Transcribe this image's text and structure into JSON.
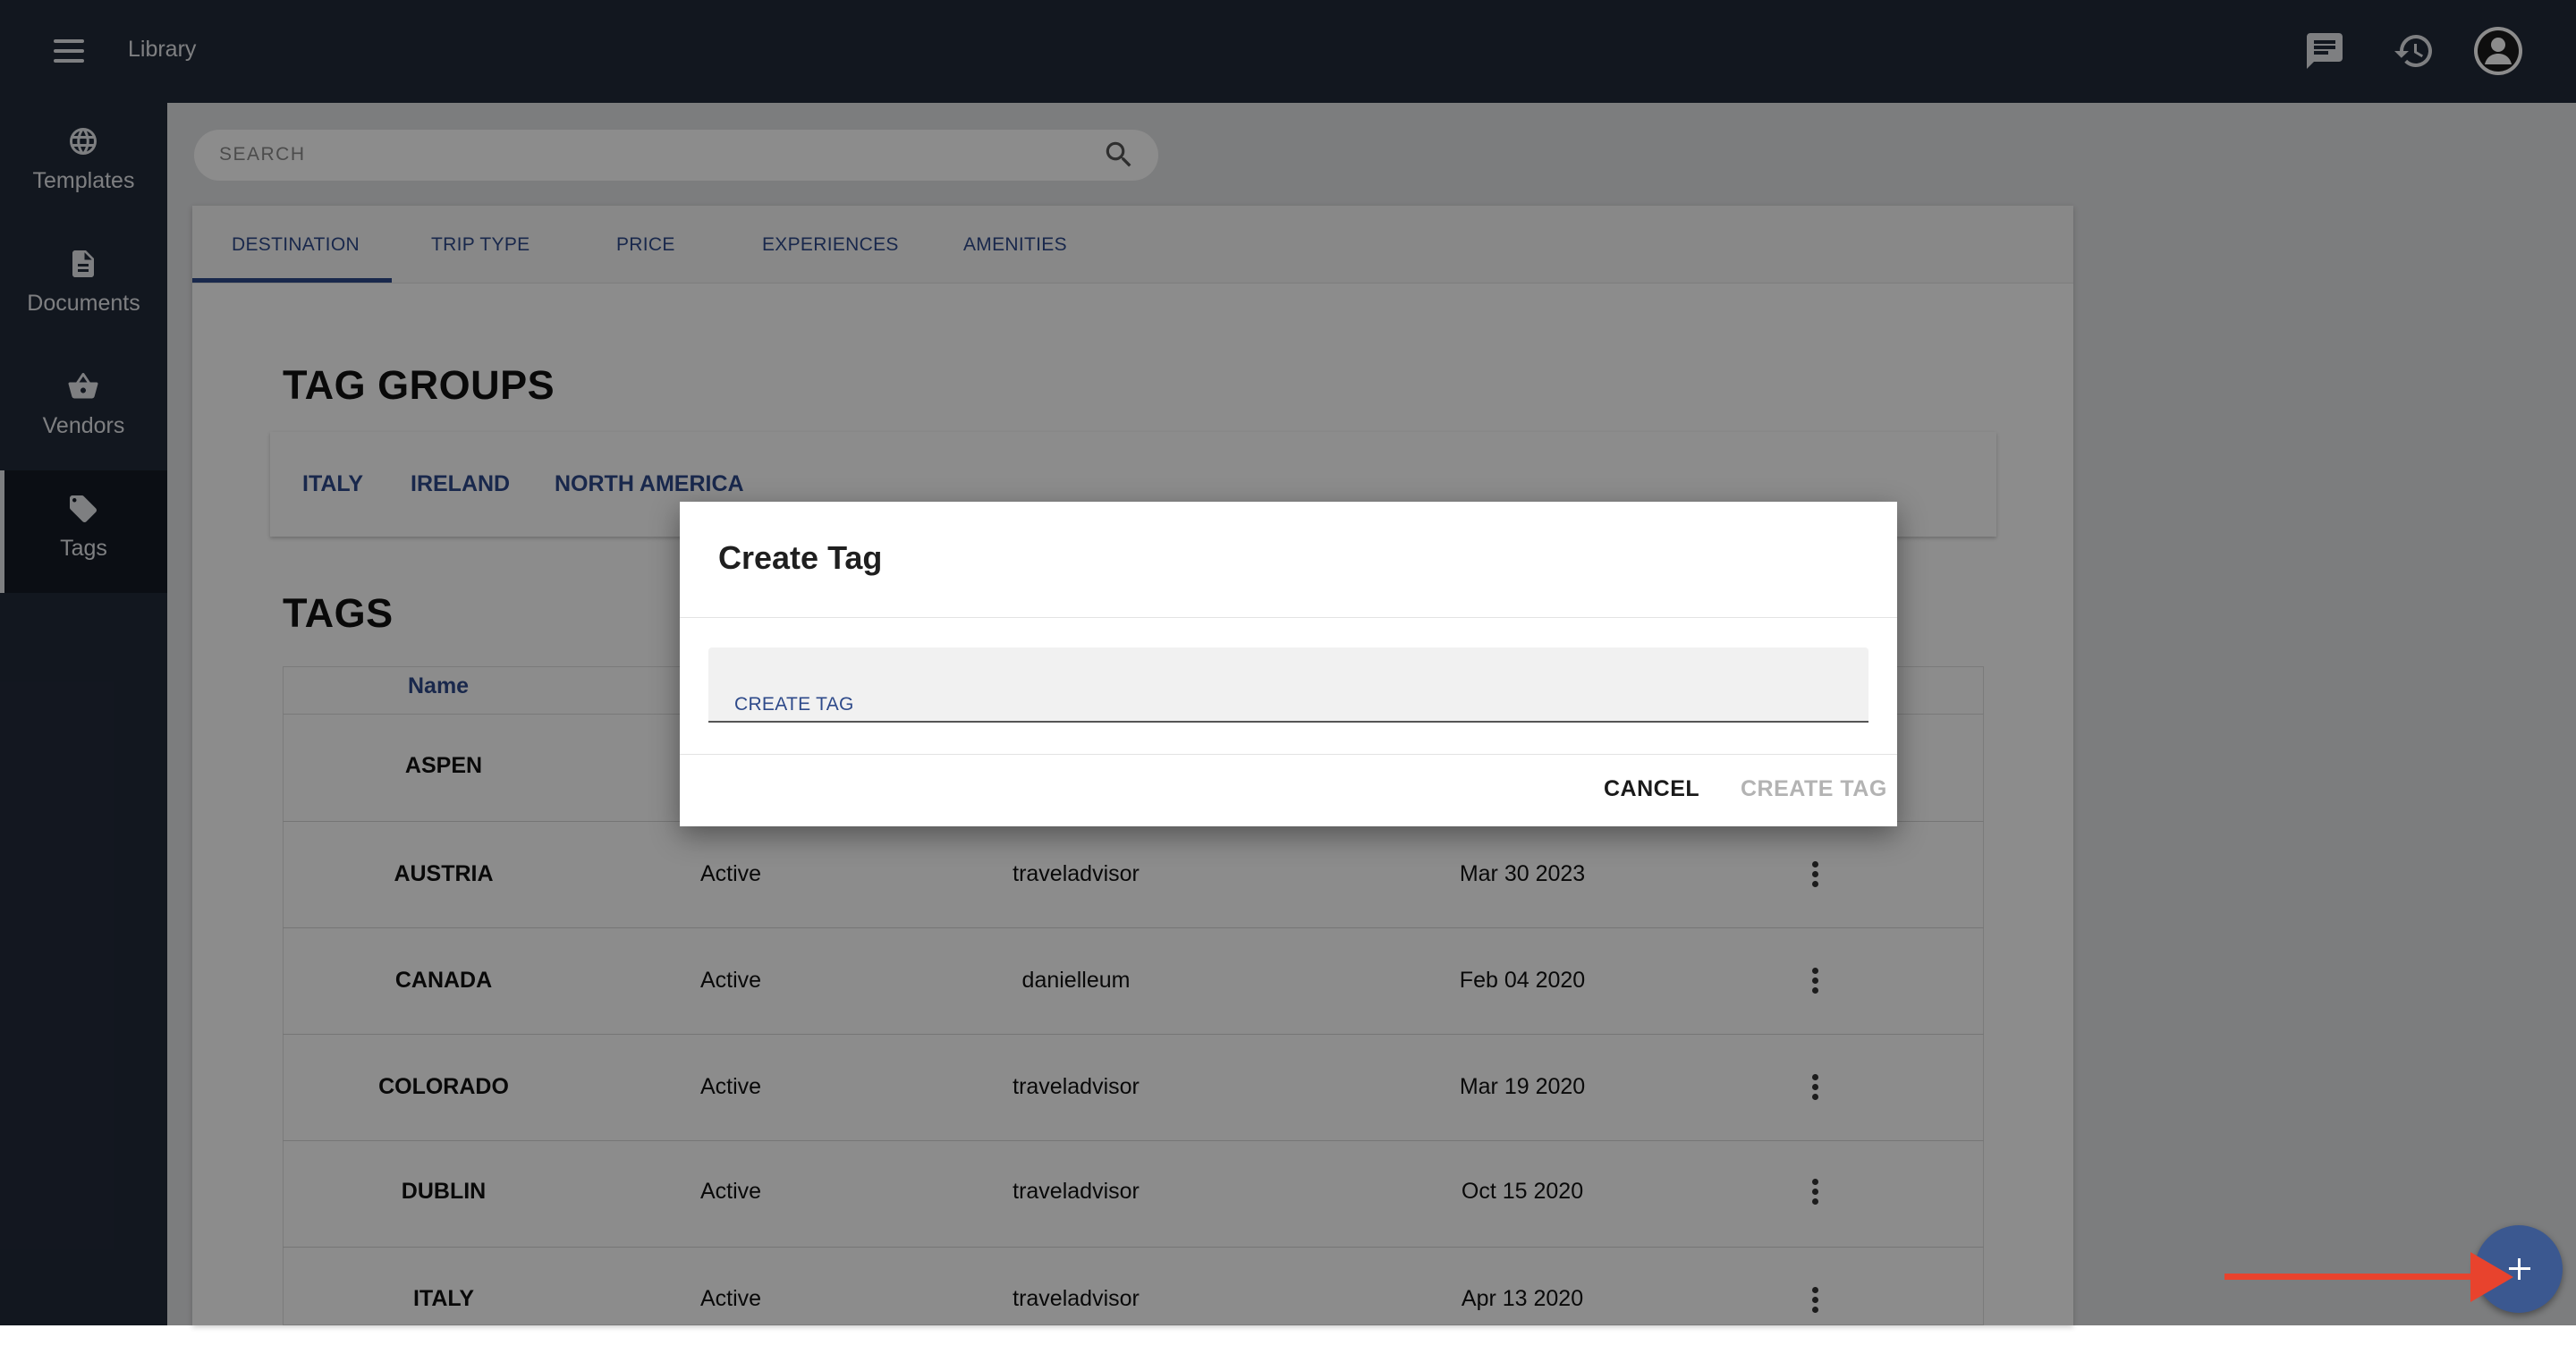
{
  "app": {
    "title": "Library"
  },
  "header": {
    "icons": [
      "chat-icon",
      "history-icon",
      "account-avatar"
    ]
  },
  "sidebar": {
    "items": [
      {
        "label": "Templates",
        "icon": "globe-icon"
      },
      {
        "label": "Documents",
        "icon": "document-icon"
      },
      {
        "label": "Vendors",
        "icon": "basket-icon"
      },
      {
        "label": "Tags",
        "icon": "tag-icon",
        "active": true
      }
    ]
  },
  "search": {
    "placeholder": "SEARCH"
  },
  "tabs": [
    "DESTINATION",
    "TRIP TYPE",
    "PRICE",
    "EXPERIENCES",
    "AMENITIES"
  ],
  "active_tab": "DESTINATION",
  "tag_groups": {
    "title": "TAG GROUPS",
    "items": [
      "ITALY",
      "IRELAND",
      "NORTH AMERICA"
    ]
  },
  "tags": {
    "title": "TAGS",
    "visible_headers": [
      "Name"
    ],
    "rows": [
      {
        "name": "ASPEN",
        "status": "",
        "user": "",
        "date": ""
      },
      {
        "name": "AUSTRIA",
        "status": "Active",
        "user": "traveladvisor",
        "date": "Mar 30 2023"
      },
      {
        "name": "CANADA",
        "status": "Active",
        "user": "danielleum",
        "date": "Feb 04 2020"
      },
      {
        "name": "COLORADO",
        "status": "Active",
        "user": "traveladvisor",
        "date": "Mar 19 2020"
      },
      {
        "name": "DUBLIN",
        "status": "Active",
        "user": "traveladvisor",
        "date": "Oct 15 2020"
      },
      {
        "name": "ITALY",
        "status": "Active",
        "user": "traveladvisor",
        "date": "Apr 13 2020"
      }
    ]
  },
  "dialog": {
    "title": "Create Tag",
    "field_label": "CREATE TAG",
    "field_value": "",
    "cancel_label": "CANCEL",
    "submit_label": "CREATE TAG",
    "submit_disabled": true
  },
  "fab": {
    "icon": "plus-icon"
  },
  "colors": {
    "header_bg": "#222a3a",
    "accent": "#2e4a8a",
    "fab": "#3b5890",
    "annotation_arrow": "#e8432d"
  }
}
